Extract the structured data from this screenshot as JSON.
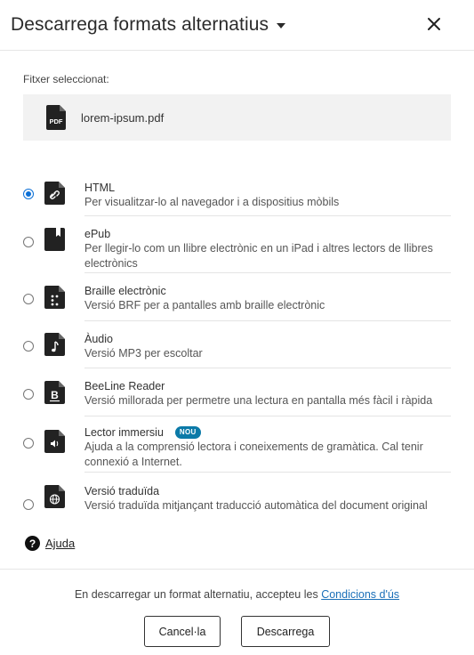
{
  "dialog": {
    "title": "Descarrega formats alternatius",
    "close_icon": "close-icon",
    "dropdown_icon": "caret-down-icon"
  },
  "selection": {
    "label": "Fitxer seleccionat:",
    "file_name": "lorem-ipsum.pdf",
    "file_icon": "pdf-file-icon",
    "file_icon_text": "PDF"
  },
  "options": [
    {
      "title": "HTML",
      "description": "Per visualitzar-lo al navegador i a dispositius mòbils",
      "icon": "link-document-icon",
      "checked": true,
      "badge": ""
    },
    {
      "title": "ePub",
      "description": "Per llegir-lo com un llibre electrònic en un iPad i altres lectors de llibres electrònics",
      "icon": "ebook-icon",
      "checked": false,
      "badge": ""
    },
    {
      "title": "Braille electrònic",
      "description": "Versió BRF per a pantalles amb braille electrònic",
      "icon": "braille-document-icon",
      "checked": false,
      "badge": ""
    },
    {
      "title": "Àudio",
      "description": "Versió MP3 per escoltar",
      "icon": "audio-document-icon",
      "checked": false,
      "badge": ""
    },
    {
      "title": "BeeLine Reader",
      "description": "Versió millorada per permetre una lectura en pantalla més fàcil i ràpida",
      "icon": "beeline-document-icon",
      "checked": false,
      "badge": ""
    },
    {
      "title": "Lector immersiu",
      "description": "Ajuda a la comprensió lectora i coneixements de gramàtica. Cal tenir connexió a Internet.",
      "icon": "immersive-reader-document-icon",
      "checked": false,
      "badge": "NOU"
    },
    {
      "title": "Versió traduïda",
      "description": "Versió traduïda mitjançant traducció automàtica del document original",
      "icon": "globe-document-icon",
      "checked": false,
      "badge": ""
    }
  ],
  "help": {
    "label": "Ajuda",
    "icon": "help-circle-icon"
  },
  "footer": {
    "terms_prefix": "En descarregar un format alternatiu, accepteu les ",
    "terms_link": "Condicions d'ús",
    "cancel_label": "Cancel·la",
    "download_label": "Descarrega"
  },
  "colors": {
    "accent": "#0b6fd6",
    "badge": "#0b7aa8",
    "link": "#1a6fb8",
    "icon": "#222222"
  }
}
